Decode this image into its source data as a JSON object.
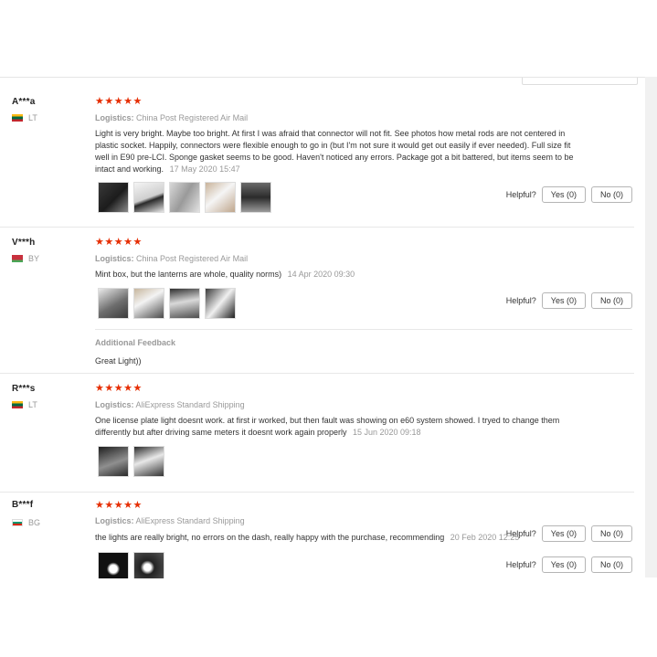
{
  "reviews": [
    {
      "user": "A***a",
      "country": "LT",
      "stars": "★★★★★",
      "logistics_label": "Logistics:",
      "logistics": "China Post Registered Air Mail",
      "text": "Light is very bright. Maybe too bright. At first I was afraid that connector will not fit. See photos how metal rods are not centered in plastic socket. Happily, connectors were flexible enough to go in (but I'm not sure it would get out easily if ever needed). Full size fit well in E90 pre-LCI. Sponge gasket seems to be good. Haven't noticed any errors. Package got a bit battered, but items seem to be intact and working.",
      "date": "17 May 2020 15:47",
      "photos": [
        "photo-1",
        "photo-2",
        "photo-3",
        "photo-4",
        "photo-5"
      ],
      "helpful_label": "Helpful?",
      "yes_label": "Yes (0)",
      "no_label": "No (0)"
    },
    {
      "user": "V***h",
      "country": "BY",
      "stars": "★★★★★",
      "logistics_label": "Logistics:",
      "logistics": "China Post Registered Air Mail",
      "text": "Mint box, but the lanterns are whole, quality norms)",
      "date": "14 Apr 2020 09:30",
      "photos": [
        "photo-1",
        "photo-2",
        "photo-3",
        "photo-4"
      ],
      "helpful_label": "Helpful?",
      "yes_label": "Yes (0)",
      "no_label": "No (0)",
      "additional_title": "Additional Feedback",
      "additional_text": "Great Light))"
    },
    {
      "user": "R***s",
      "country": "LT",
      "stars": "★★★★★",
      "logistics_label": "Logistics:",
      "logistics": "AliExpress Standard Shipping",
      "text": "One license plate light doesnt work. at first ir worked, but then fault was showing on e60 system showed. I tryed to change them differently but after driving same meters it doesnt work again properly",
      "date": "15 Jun 2020 09:18",
      "photos": [
        "photo-1",
        "photo-2"
      ],
      "helpful_label": "Helpful?",
      "yes_label": "Yes (0)",
      "no_label": "No (0)"
    },
    {
      "user": "B***f",
      "country": "BG",
      "stars": "★★★★★",
      "logistics_label": "Logistics:",
      "logistics": "AliExpress Standard Shipping",
      "text": "the lights are really bright, no errors on the dash, really happy with the purchase, recommending",
      "date": "20 Feb 2020 12:25",
      "photos": [
        "photo-1",
        "photo-2"
      ],
      "helpful_label": "Helpful?",
      "yes_label": "Yes (0)",
      "no_label": "No (0)"
    }
  ]
}
